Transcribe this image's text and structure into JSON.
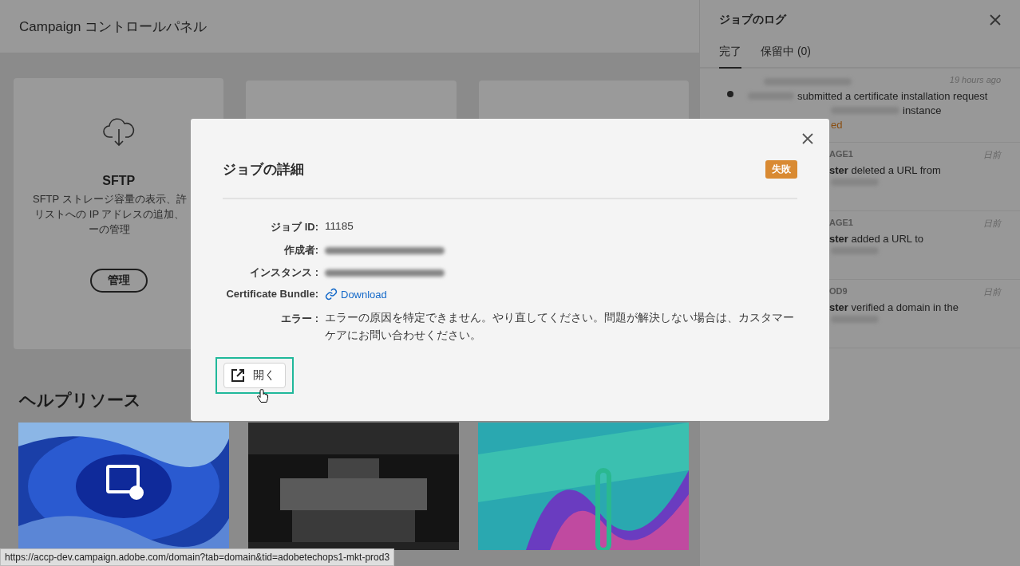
{
  "page": {
    "title": "Campaign コントロールパネル"
  },
  "cards": [
    {
      "kind": "service",
      "title": "SFTP",
      "description": [
        "SFTP ストレージ容量の表示、許",
        "リストへの IP アドレスの追加、",
        "ーの管理"
      ],
      "button": "管理"
    },
    {
      "kind": "empty"
    },
    {
      "kind": "empty"
    }
  ],
  "help": {
    "title": "ヘルプリソース"
  },
  "status_url": "https://accp-dev.campaign.adobe.com/domain?tab=domain&tid=adobetechops1-mkt-prod3",
  "log": {
    "title": "ジョブのログ",
    "tabs": [
      {
        "label": "完了",
        "selected": true
      },
      {
        "label": "保留中 (0)",
        "selected": false
      }
    ],
    "items": [
      {
        "kind": "first",
        "time": "19 hours ago",
        "line1": "submitted a certificate installation request",
        "line2": "instance",
        "status": "ed"
      },
      {
        "kind": "other",
        "header": "AGE1",
        "time": "日前",
        "actor": "ster",
        "text": "deleted a URL from"
      },
      {
        "kind": "other",
        "header": "AGE1",
        "time": "日前",
        "actor": "ster",
        "text": "added a URL to"
      },
      {
        "kind": "other",
        "header": "OD9",
        "time": "日前",
        "actor": "ster",
        "text": "verified a domain in the"
      }
    ]
  },
  "modal": {
    "title": "ジョブの詳細",
    "status": "失敗",
    "fields": [
      {
        "kind": "text",
        "label": "ジョブ ID:",
        "value": "11185"
      },
      {
        "kind": "blurred",
        "label": "作成者:"
      },
      {
        "kind": "blurred",
        "label": "インスタンス :"
      },
      {
        "kind": "link",
        "label": "Certificate Bundle:",
        "value": "Download"
      },
      {
        "kind": "text",
        "label": "エラー :",
        "value": "エラーの原因を特定できません。やり直してください。問題が解決しない場合は、カスタマーケアにお問い合わせください。"
      }
    ],
    "button": {
      "label": "開く",
      "focused": true
    }
  }
}
